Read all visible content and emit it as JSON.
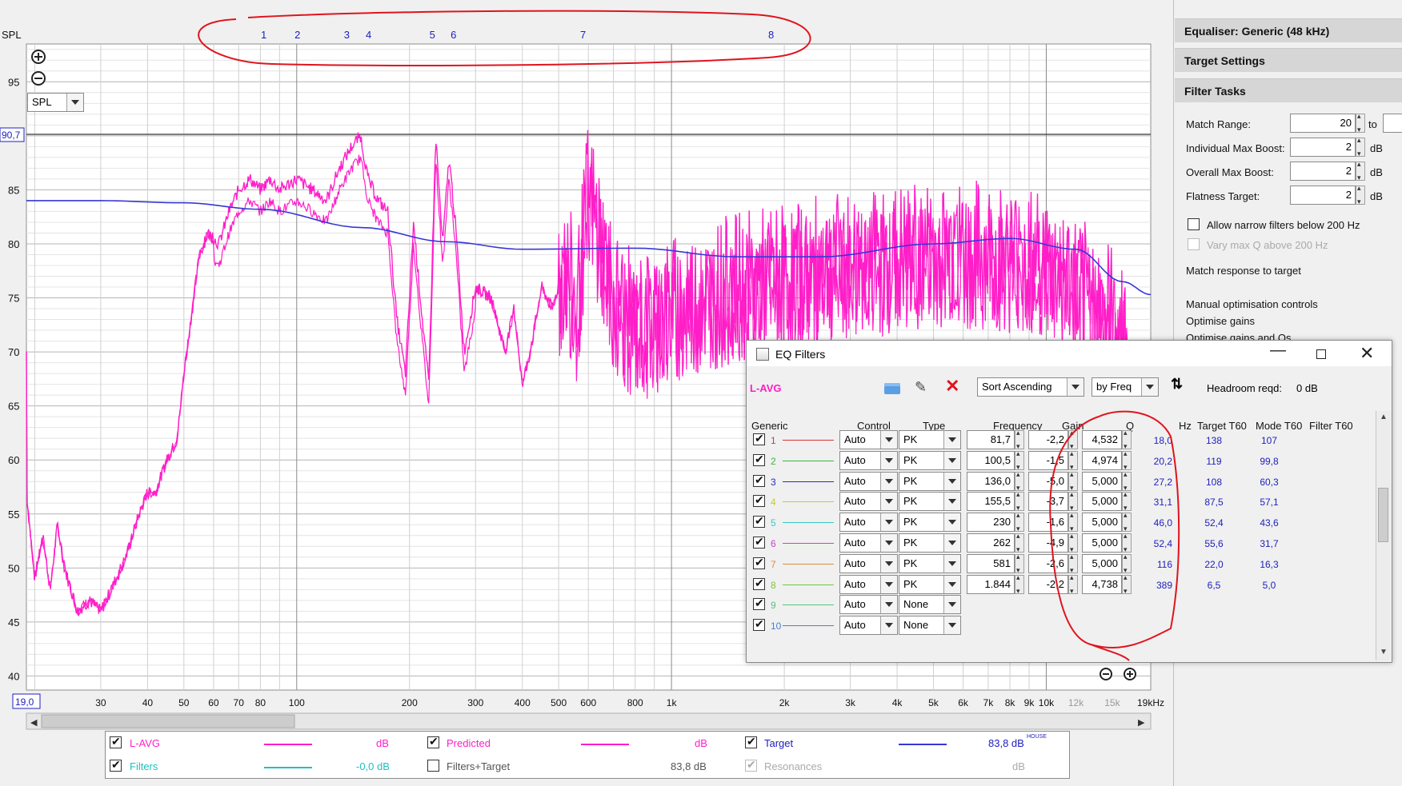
{
  "colors": {
    "lavg": "#ff1ec8",
    "target": "#3636d6",
    "filters": "#20c0c0",
    "accent_red": "#e0141e",
    "blue_text": "#2020c0"
  },
  "plot": {
    "y_axis_title": "SPL",
    "y_ticks": [
      "95",
      "90",
      "85",
      "80",
      "75",
      "70",
      "65",
      "60",
      "55",
      "50",
      "45",
      "40"
    ],
    "y_cursor_value": "90,7",
    "x_cursor_value": "19,0",
    "x_ticks": [
      "30",
      "40",
      "50",
      "60",
      "70",
      "80",
      "100",
      "200",
      "300",
      "400",
      "500",
      "600",
      "800",
      "1k",
      "2k",
      "3k",
      "4k",
      "5k",
      "6k",
      "7k",
      "8k",
      "9k",
      "10k",
      "12k",
      "15k",
      "19kHz"
    ],
    "filter_markers": [
      "1",
      "2",
      "3",
      "4",
      "5",
      "6",
      "7",
      "8"
    ],
    "mode_select": "SPL",
    "zoom_in_icon": "zoom-in-icon",
    "zoom_out_icon": "zoom-out-icon"
  },
  "legend": {
    "lavg": {
      "label": "L-AVG",
      "value": "dB"
    },
    "predicted": {
      "label": "Predicted",
      "value": "dB"
    },
    "target": {
      "label": "Target",
      "value": "83,8 dB",
      "sup": "HOUSE"
    },
    "filters": {
      "label": "Filters",
      "value": "-0,0 dB"
    },
    "filters_target": {
      "label": "Filters+Target",
      "value": "83,8 dB"
    },
    "resonances": {
      "label": "Resonances",
      "value": "dB"
    }
  },
  "right_panel": {
    "equaliser": "Equaliser: Generic (48 kHz)",
    "target_settings": "Target Settings",
    "filter_tasks": "Filter Tasks",
    "match_range_label": "Match Range:",
    "match_range_value": "20",
    "match_range_to": "to",
    "indiv_max_boost_label": "Individual Max Boost:",
    "indiv_max_boost_value": "2",
    "overall_max_boost_label": "Overall Max Boost:",
    "overall_max_boost_value": "2",
    "flatness_target_label": "Flatness Target:",
    "flatness_target_value": "2",
    "unit_db": "dB",
    "allow_narrow": "Allow narrow filters below 200 Hz",
    "vary_max_q": "Vary max Q above 200 Hz",
    "match_response": "Match response to target",
    "manual_opt": "Manual optimisation controls",
    "optimise_gains": "Optimise gains",
    "optimise_gains_qs": "Optimise gains and Qs"
  },
  "eq_window": {
    "title": "EQ Filters",
    "measurement": "L-AVG",
    "sort_order": "Sort Ascending",
    "sort_by": "by Freq",
    "headroom_label": "Headroom reqd:",
    "headroom_value": "0 dB",
    "headers": {
      "generic": "Generic",
      "control": "Control",
      "type": "Type",
      "frequency": "Frequency",
      "gain": "Gain",
      "q": "Q",
      "hz": "Hz",
      "target_t60": "Target T60",
      "mode_t60": "Mode T60",
      "filter_t60": "Filter T60"
    },
    "filters": [
      {
        "num": "1",
        "color": "#e03232",
        "control": "Auto",
        "type": "PK",
        "freq": "81,7",
        "gain": "-2,2",
        "q": "4,532",
        "hz": "18,0",
        "target_t60": "138",
        "mode_t60": "107",
        "filter_t60": ""
      },
      {
        "num": "2",
        "color": "#3cb43c",
        "control": "Auto",
        "type": "PK",
        "freq": "100,5",
        "gain": "-1,5",
        "q": "4,974",
        "hz": "20,2",
        "target_t60": "119",
        "mode_t60": "99,8",
        "filter_t60": ""
      },
      {
        "num": "3",
        "color": "#2828c8",
        "control": "Auto",
        "type": "PK",
        "freq": "136,0",
        "gain": "-5,0",
        "q": "5,000",
        "hz": "27,2",
        "target_t60": "108",
        "mode_t60": "60,3",
        "filter_t60": ""
      },
      {
        "num": "4",
        "color": "#c8c83c",
        "control": "Auto",
        "type": "PK",
        "freq": "155,5",
        "gain": "-3,7",
        "q": "5,000",
        "hz": "31,1",
        "target_t60": "87,5",
        "mode_t60": "57,1",
        "filter_t60": ""
      },
      {
        "num": "5",
        "color": "#3cc8c8",
        "control": "Auto",
        "type": "PK",
        "freq": "230",
        "gain": "-1,6",
        "q": "5,000",
        "hz": "46,0",
        "target_t60": "52,4",
        "mode_t60": "43,6",
        "filter_t60": ""
      },
      {
        "num": "6",
        "color": "#d23cd2",
        "control": "Auto",
        "type": "PK",
        "freq": "262",
        "gain": "-4,9",
        "q": "5,000",
        "hz": "52,4",
        "target_t60": "55,6",
        "mode_t60": "31,7",
        "filter_t60": ""
      },
      {
        "num": "7",
        "color": "#dc8c3c",
        "control": "Auto",
        "type": "PK",
        "freq": "581",
        "gain": "-2,6",
        "q": "5,000",
        "hz": "116",
        "target_t60": "22,0",
        "mode_t60": "16,3",
        "filter_t60": ""
      },
      {
        "num": "8",
        "color": "#78c83c",
        "control": "Auto",
        "type": "PK",
        "freq": "1.844",
        "gain": "-2,2",
        "q": "4,738",
        "hz": "389",
        "target_t60": "6,5",
        "mode_t60": "5,0",
        "filter_t60": ""
      },
      {
        "num": "9",
        "color": "#50c878",
        "control": "Auto",
        "type": "None",
        "freq": "",
        "gain": "",
        "q": "",
        "hz": "",
        "target_t60": "",
        "mode_t60": "",
        "filter_t60": ""
      },
      {
        "num": "10",
        "color": "#4682d2",
        "control": "Auto",
        "type": "None",
        "freq": "",
        "gain": "",
        "q": "",
        "hz": "",
        "target_t60": "",
        "mode_t60": "",
        "filter_t60": ""
      }
    ]
  }
}
